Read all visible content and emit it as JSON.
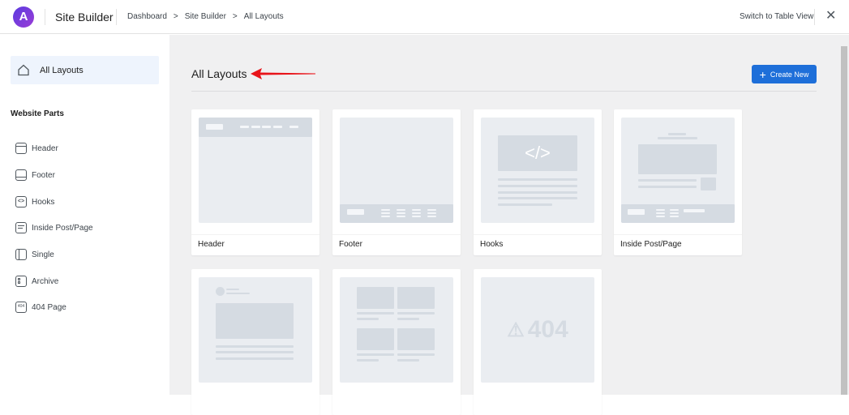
{
  "header": {
    "logo_letter": "A",
    "title": "Site Builder",
    "breadcrumbs": [
      "Dashboard",
      "Site Builder",
      "All Layouts"
    ],
    "separator": ">",
    "switch_view": "Switch to Table View",
    "close": "✕"
  },
  "sidebar": {
    "all_layouts": "All Layouts",
    "section_heading": "Website Parts",
    "items": [
      {
        "label": "Header",
        "icon": "header-icon"
      },
      {
        "label": "Footer",
        "icon": "footer-icon"
      },
      {
        "label": "Hooks",
        "icon": "code-icon"
      },
      {
        "label": "Inside Post/Page",
        "icon": "inside-post-icon"
      },
      {
        "label": "Single",
        "icon": "single-icon"
      },
      {
        "label": "Archive",
        "icon": "archive-icon"
      },
      {
        "label": "404 Page",
        "icon": "404-icon",
        "icon_text": "404"
      }
    ]
  },
  "main": {
    "title": "All Layouts",
    "create_button": "Create New",
    "create_icon": "+",
    "cards": [
      {
        "label": "Header"
      },
      {
        "label": "Footer"
      },
      {
        "label": "Hooks"
      },
      {
        "label": "Inside Post/Page"
      },
      {
        "label": ""
      },
      {
        "label": ""
      },
      {
        "label": ""
      }
    ],
    "code_glyph": "</>",
    "error_text": "404",
    "warning_glyph": "⚠"
  },
  "colors": {
    "accent": "#1e6fd9",
    "arrow": "#e8141a",
    "background": "#f0f0f1"
  }
}
